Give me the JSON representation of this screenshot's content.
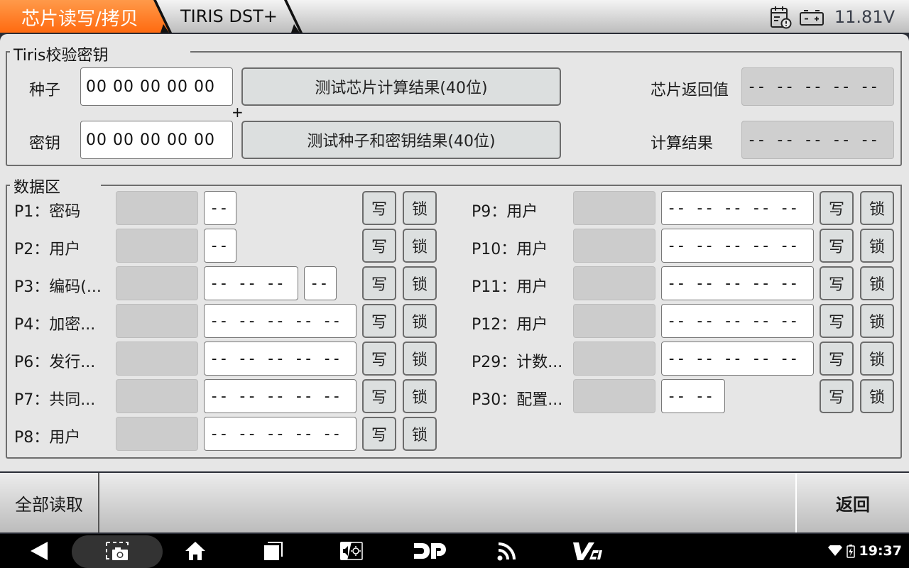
{
  "header": {
    "tabs": [
      {
        "label": "芯片读写/拷贝",
        "active": true
      },
      {
        "label": "TIRIS DST+",
        "active": false
      }
    ],
    "voltage": "11.81V",
    "accent_color": "#ff7a1e"
  },
  "key_section": {
    "title": "Tiris校验密钥",
    "seed_label": "种子",
    "seed_value": "00 00 00 00 00",
    "key_label": "密钥",
    "key_value": "00 00 00 00 00",
    "plus": "+",
    "test_chip_button": "测试芯片计算结果(40位)",
    "test_seed_key_button": "测试种子和密钥结果(40位)",
    "chip_return_label": "芯片返回值",
    "chip_return_value": "-- -- -- -- --",
    "calc_result_label": "计算结果",
    "calc_result_value": "-- -- -- -- --"
  },
  "data_section": {
    "title": "数据区",
    "write_label": "写",
    "lock_label": "锁",
    "left_rows": [
      {
        "label": "P1：密码",
        "fields": [
          "--"
        ]
      },
      {
        "label": "P2：用户",
        "fields": [
          "--"
        ]
      },
      {
        "label": "P3：编码(...",
        "fields": [
          "-- -- --",
          "--"
        ]
      },
      {
        "label": "P4：加密...",
        "fields": [
          "-- -- -- -- --"
        ]
      },
      {
        "label": "P6：发行...",
        "fields": [
          "-- -- -- -- --"
        ]
      },
      {
        "label": "P7：共同...",
        "fields": [
          "-- -- -- -- --"
        ]
      },
      {
        "label": "P8：用户",
        "fields": [
          "-- -- -- -- --"
        ]
      }
    ],
    "right_rows": [
      {
        "label": "P9：用户",
        "fields": [
          "-- -- -- -- --"
        ]
      },
      {
        "label": "P10：用户",
        "fields": [
          "-- -- -- -- --"
        ]
      },
      {
        "label": "P11：用户",
        "fields": [
          "-- -- -- -- --"
        ]
      },
      {
        "label": "P12：用户",
        "fields": [
          "-- -- -- -- --"
        ]
      },
      {
        "label": "P29：计数...",
        "fields": [
          "-- -- -- -- --"
        ]
      },
      {
        "label": "P30：配置...",
        "fields": [
          "-- --"
        ]
      }
    ]
  },
  "toolbar": {
    "read_all": "全部读取",
    "back": "返回"
  },
  "navbar": {
    "icons": [
      "back-icon",
      "screenshot-icon",
      "home-icon",
      "recents-icon",
      "volume-brightness-icon",
      "dp-icon",
      "signal-icon",
      "vci-icon"
    ],
    "time": "19:37"
  }
}
